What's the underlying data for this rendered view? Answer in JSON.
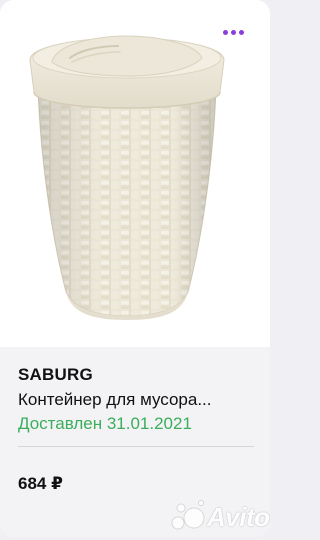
{
  "listing": {
    "brand": "SABURG",
    "title": "Контейнер для мусора...",
    "status": "Доставлен 31.01.2021",
    "price": "684 ₽"
  },
  "image": {
    "subject": "rattan-style bin with swing lid"
  },
  "watermark": {
    "text": "Avito"
  },
  "icons": {
    "more": "more-horizontal-icon"
  },
  "colors": {
    "accent": "#8b3fd9",
    "status_green": "#3aae5b",
    "card_info_bg": "#f3f3f6",
    "product_ivory": "#ece8d9"
  }
}
